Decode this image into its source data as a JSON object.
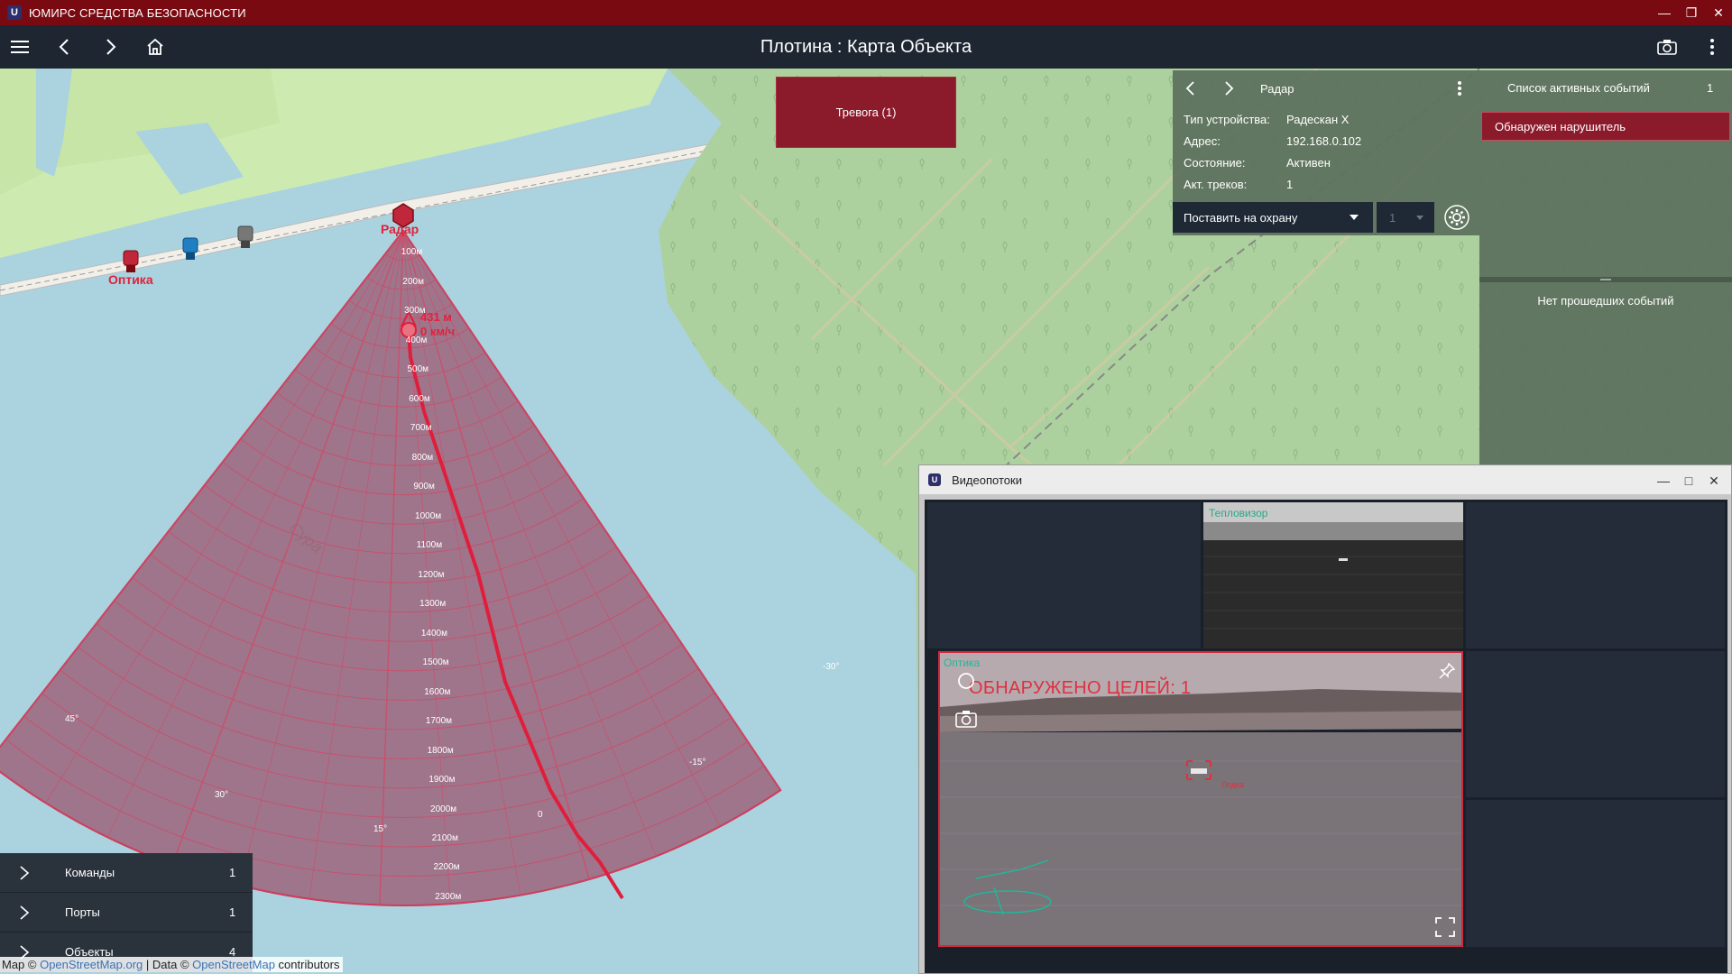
{
  "app": {
    "title": "ЮМИРС СРЕДСТВА БЕЗОПАСНОСТИ",
    "logo_letter": "U"
  },
  "toolbar": {
    "page_title": "Плотина : Карта Объекта"
  },
  "alarm": {
    "label": "Тревога (1)"
  },
  "map": {
    "labels": {
      "radar": "Радар",
      "optic": "Оптика",
      "river": "Сура"
    },
    "track": {
      "distance": "431 м",
      "speed": "0 км/ч"
    },
    "ranges": [
      "100м",
      "200м",
      "300м",
      "400м",
      "500м",
      "600м",
      "700м",
      "800м",
      "900м",
      "1000м",
      "1100м",
      "1200м",
      "1300м",
      "1400м",
      "1500м",
      "1600м",
      "1700м",
      "1800м",
      "1900м",
      "2000м",
      "2100м",
      "2200м",
      "2300м"
    ],
    "angles": [
      "45°",
      "30°",
      "15°",
      "0",
      "-15°",
      "-30°"
    ],
    "attribution": {
      "prefix": "Map © ",
      "osm": "OpenStreetMap.org",
      "mid": " | Data © ",
      "osm2": "OpenStreetMap",
      "suffix": " contributors"
    }
  },
  "device": {
    "name": "Радар",
    "rows": [
      {
        "label": "Тип устройства:",
        "value": "Радескан X"
      },
      {
        "label": "Адрес:",
        "value": "192.168.0.102"
      },
      {
        "label": "Состояние:",
        "value": "Активен"
      },
      {
        "label": "Акт. треков:",
        "value": "1"
      }
    ],
    "guard_select": "Поставить на охрану",
    "number_select": "1"
  },
  "events": {
    "title": "Список активных событий",
    "count": "1",
    "active": [
      "Обнаружен нарушитель"
    ],
    "past_empty": "Нет прошедших событий"
  },
  "side_list": [
    {
      "label": "Команды",
      "count": "1"
    },
    {
      "label": "Порты",
      "count": "1"
    },
    {
      "label": "Объекты",
      "count": "4"
    }
  ],
  "video": {
    "title": "Видеопотоки",
    "thermal_name": "Тепловизор",
    "optic_name": "Оптика",
    "detect_text": "ОБНАРУЖЕНО ЦЕЛЕЙ: 1",
    "target_label": "Лодка"
  },
  "colors": {
    "titlebar": "#7a0a12",
    "toolbar": "#1e2631",
    "alarm": "#8b1a2b",
    "sector": "#c8324a",
    "water": "#aad3df",
    "forest": "#add19e"
  }
}
